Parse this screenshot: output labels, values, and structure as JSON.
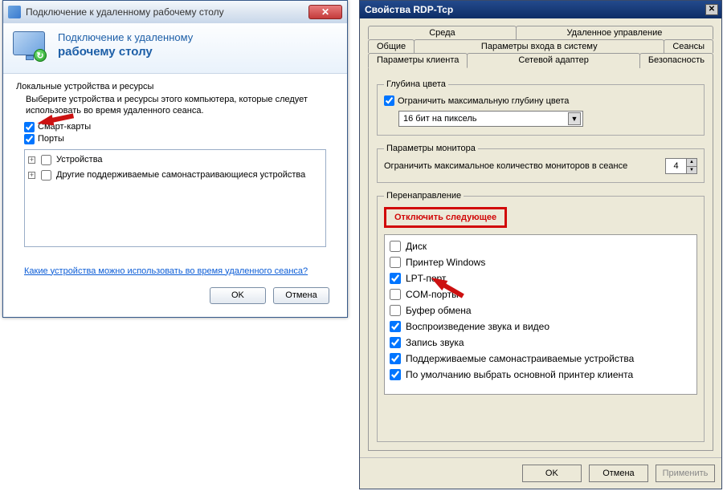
{
  "left": {
    "title": "Подключение к удаленному рабочему столу",
    "banner_line1": "Подключение к удаленному",
    "banner_line2": "рабочему столу",
    "section_title": "Локальные устройства и ресурсы",
    "section_desc": "Выберите устройства и ресурсы этого компьютера, которые следует использовать во время удаленного сеанса.",
    "check_smartcards_label": "Смарт-карты",
    "check_smartcards_checked": true,
    "check_ports_label": "Порты",
    "check_ports_checked": true,
    "tree_item_devices": "Устройства",
    "tree_item_pnp": "Другие поддерживаемые самонастраивающиеся устройства",
    "help_link": "Какие устройства можно использовать во время удаленного сеанса?",
    "ok": "OK",
    "cancel": "Отмена"
  },
  "right": {
    "title": "Свойства RDP-Tcp",
    "tabs": {
      "row1": [
        "Среда",
        "Удаленное управление"
      ],
      "row2": [
        "Общие",
        "Параметры входа в систему",
        "Сеансы"
      ],
      "row3": [
        "Параметры клиента",
        "Сетевой адаптер",
        "Безопасность"
      ]
    },
    "active_tab": "Параметры клиента",
    "color_depth": {
      "legend": "Глубина цвета",
      "checkbox_label": "Ограничить максимальную глубину цвета",
      "checkbox_checked": true,
      "select_value": "16 бит на пиксель"
    },
    "monitors": {
      "legend": "Параметры монитора",
      "label": "Ограничить максимальное количество мониторов в сеансе",
      "value": "4"
    },
    "redirection": {
      "legend": "Перенаправление",
      "disable_label": "Отключить следующее",
      "items": [
        {
          "label": "Диск",
          "checked": false
        },
        {
          "label": "Принтер Windows",
          "checked": false
        },
        {
          "label": "LPT-порт",
          "checked": true
        },
        {
          "label": "COM-порты",
          "checked": false
        },
        {
          "label": "Буфер обмена",
          "checked": false
        },
        {
          "label": "Воспроизведение звука и видео",
          "checked": true
        },
        {
          "label": "Запись звука",
          "checked": true
        },
        {
          "label": "Поддерживаемые самонастраиваемые устройства",
          "checked": true
        },
        {
          "label": "По умолчанию выбрать основной принтер клиента",
          "checked": true
        }
      ]
    },
    "ok": "OK",
    "cancel": "Отмена",
    "apply": "Применить"
  }
}
